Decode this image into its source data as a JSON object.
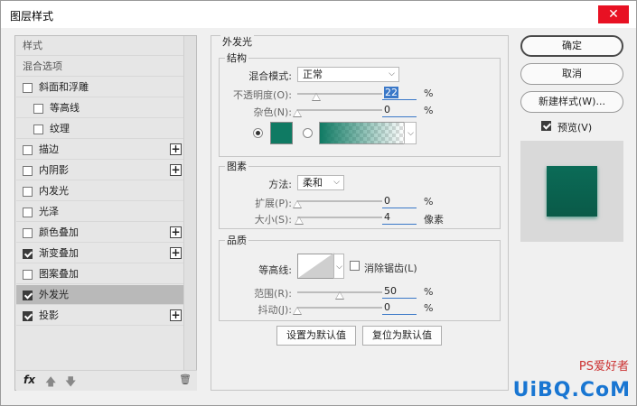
{
  "window": {
    "title": "图层样式",
    "close": "✕"
  },
  "left": {
    "items": [
      {
        "label": "样式",
        "checkbox": false,
        "checked": false,
        "plus": false,
        "indent": 0,
        "dim": true
      },
      {
        "label": "混合选项",
        "checkbox": false,
        "checked": false,
        "plus": false,
        "indent": 0,
        "dim": true
      },
      {
        "label": "斜面和浮雕",
        "checkbox": true,
        "checked": false,
        "plus": false,
        "indent": 0
      },
      {
        "label": "等高线",
        "checkbox": true,
        "checked": false,
        "plus": false,
        "indent": 1
      },
      {
        "label": "纹理",
        "checkbox": true,
        "checked": false,
        "plus": false,
        "indent": 1
      },
      {
        "label": "描边",
        "checkbox": true,
        "checked": false,
        "plus": true,
        "indent": 0
      },
      {
        "label": "内阴影",
        "checkbox": true,
        "checked": false,
        "plus": true,
        "indent": 0
      },
      {
        "label": "内发光",
        "checkbox": true,
        "checked": false,
        "plus": false,
        "indent": 0
      },
      {
        "label": "光泽",
        "checkbox": true,
        "checked": false,
        "plus": false,
        "indent": 0
      },
      {
        "label": "颜色叠加",
        "checkbox": true,
        "checked": false,
        "plus": true,
        "indent": 0
      },
      {
        "label": "渐变叠加",
        "checkbox": true,
        "checked": true,
        "plus": true,
        "indent": 0
      },
      {
        "label": "图案叠加",
        "checkbox": true,
        "checked": false,
        "plus": false,
        "indent": 0
      },
      {
        "label": "外发光",
        "checkbox": true,
        "checked": true,
        "plus": false,
        "indent": 0,
        "selected": true
      },
      {
        "label": "投影",
        "checkbox": true,
        "checked": true,
        "plus": true,
        "indent": 0
      }
    ],
    "fx": "fx",
    "up": "🡅",
    "down": "🡇",
    "trash": "🗑"
  },
  "center": {
    "panel_title": "外发光",
    "structure": {
      "title": "结构",
      "blend_mode_label": "混合模式:",
      "blend_mode_value": "正常",
      "opacity_label": "不透明度(O):",
      "opacity_value": "22",
      "opacity_level": 0.22,
      "noise_label": "杂色(N):",
      "noise_value": "0",
      "noise_level": 0.0,
      "percent": "%",
      "color": "#0f7a63"
    },
    "elements": {
      "title": "图素",
      "method_label": "方法:",
      "method_value": "柔和",
      "spread_label": "扩展(P):",
      "spread_value": "0",
      "spread_level": 0.0,
      "size_label": "大小(S):",
      "size_value": "4",
      "size_level": 0.02,
      "percent": "%",
      "pixels": "像素"
    },
    "quality": {
      "title": "品质",
      "contour_label": "等高线:",
      "antialias_label": "消除锯齿(L)",
      "range_label": "范围(R):",
      "range_value": "50",
      "range_level": 0.5,
      "jitter_label": "抖动(J):",
      "jitter_value": "0",
      "jitter_level": 0.0,
      "percent": "%"
    },
    "set_default": "设置为默认值",
    "reset_default": "复位为默认值"
  },
  "right": {
    "ok": "确定",
    "cancel": "取消",
    "new_style": "新建样式(W)...",
    "preview_label": "预览(V)",
    "preview_checked": true
  },
  "watermark": {
    "text": "UiBQ.CoM",
    "sub": "PS爱好者",
    "color": "#1976d2"
  }
}
